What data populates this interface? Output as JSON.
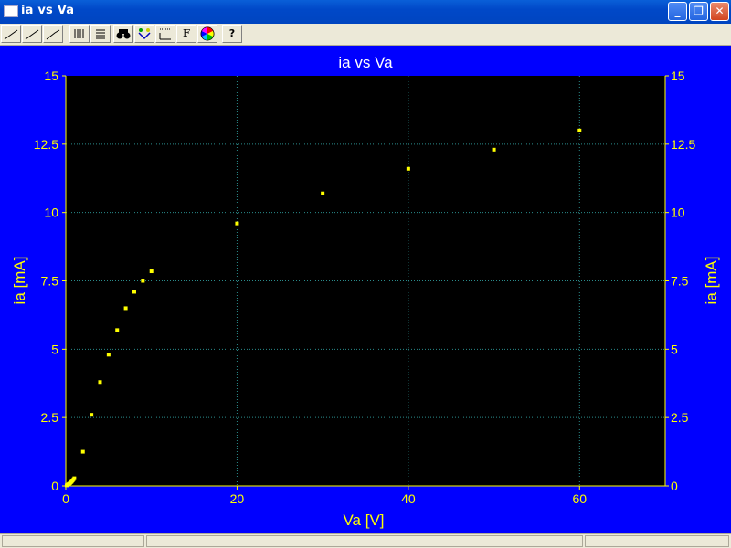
{
  "window": {
    "title": "ia vs Va"
  },
  "toolbar": {
    "buttons": [
      {
        "icon": "line-plot-icon"
      },
      {
        "icon": "line-plot-icon"
      },
      {
        "icon": "line-plot-icon"
      },
      {
        "icon": "bars-icon"
      },
      {
        "icon": "list-icon"
      },
      {
        "icon": "binoculars-icon"
      },
      {
        "icon": "filter-icon"
      },
      {
        "icon": "axis-scale-icon"
      },
      {
        "icon": "font-icon",
        "glyph": "F"
      },
      {
        "icon": "color-wheel-icon"
      },
      {
        "icon": "help-icon",
        "glyph": "?"
      }
    ]
  },
  "colors": {
    "panel": "#0000ff",
    "plot_bg": "#000000",
    "text": "#ffff00",
    "grid": "#2a8c8c",
    "title": "#ffffff",
    "points": "#ffff00"
  },
  "chart_data": {
    "type": "scatter",
    "title": "ia vs Va",
    "xlabel": "Va [V]",
    "ylabel": "ia [mA]",
    "ylabel_right": "ia [mA]",
    "xlim": [
      0,
      70
    ],
    "ylim": [
      0,
      15
    ],
    "x_ticks": [
      0,
      20,
      40,
      60
    ],
    "x_tick_labels": [
      "0",
      "20",
      "40",
      "60"
    ],
    "y_ticks": [
      0,
      2.5,
      5,
      7.5,
      10,
      12.5,
      15
    ],
    "y_tick_labels": [
      "0",
      "2.5",
      "5",
      "7.5",
      "10",
      "12.5",
      "15"
    ],
    "grid": true,
    "series": [
      {
        "x": [
          0.1,
          0.2,
          0.3,
          0.4,
          0.5,
          0.6,
          0.7,
          0.8,
          0.9,
          1,
          2,
          3,
          4,
          5,
          6,
          7,
          8,
          9,
          10,
          20,
          30,
          40,
          50,
          60
        ],
        "y": [
          0.02,
          0.04,
          0.06,
          0.08,
          0.1,
          0.13,
          0.16,
          0.2,
          0.24,
          0.28,
          1.25,
          2.6,
          3.8,
          4.8,
          5.7,
          6.5,
          7.1,
          7.5,
          7.85,
          9.6,
          10.7,
          11.6,
          12.3,
          13.0
        ]
      }
    ]
  }
}
